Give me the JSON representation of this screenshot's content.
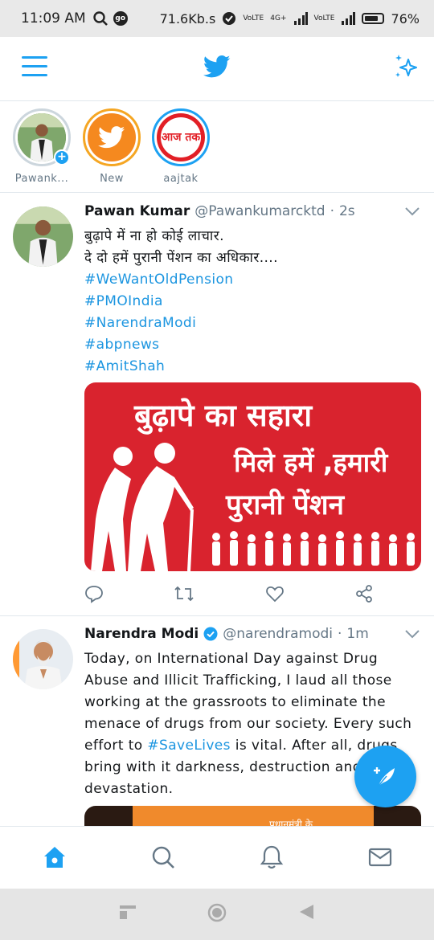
{
  "status_bar": {
    "time": "11:09 AM",
    "net_speed": "71.6Kb.s",
    "network_labels": [
      "VoLTE",
      "4G+",
      "VoLTE"
    ],
    "battery": "76%"
  },
  "app_bar": {
    "menu_icon": "hamburger-icon",
    "logo_icon": "twitter-bird-icon",
    "sparkle_icon": "sparkle-icon"
  },
  "fleets": [
    {
      "label": "Pawank...",
      "kind": "self"
    },
    {
      "label": "New",
      "kind": "twitter"
    },
    {
      "label": "aajtak",
      "kind": "aajtak",
      "logo_text": "आज तक"
    }
  ],
  "tweets": [
    {
      "name": "Pawan Kumar",
      "handle": "@Pawankumarcktd",
      "time": "2s",
      "lines": [
        "बुढ़ापे में ना हो कोई लाचार.",
        "दे दो हमें पुरानी पेंशन का अधिकार...."
      ],
      "hashtags": [
        "#WeWantOldPension",
        "#PMOIndia",
        "#NarendraModi",
        "#abpnews",
        "#AmitShah"
      ],
      "image_text": {
        "line1": "बुढ़ापे का सहारा",
        "line2": "मिले हमें ,हमारी",
        "line3": "पुरानी पेंशन"
      }
    },
    {
      "name": "Narendra Modi",
      "verified": true,
      "handle": "@narendramodi",
      "time": "1m",
      "text_before": "Today, on International Day against Drug Abuse and Illicit Trafficking, I laud all those working at the grassroots to eliminate the menace of drugs from our society. Every such effort to ",
      "hashtag": "#SaveLives",
      "text_after": " is vital. After all, drugs bring with it darkness, destruction and devastation.",
      "image_caption": "प्रधानमंत्री के"
    }
  ],
  "colors": {
    "accent": "#1da1f2",
    "link": "#1b95e0",
    "image_red": "#d9232e"
  }
}
